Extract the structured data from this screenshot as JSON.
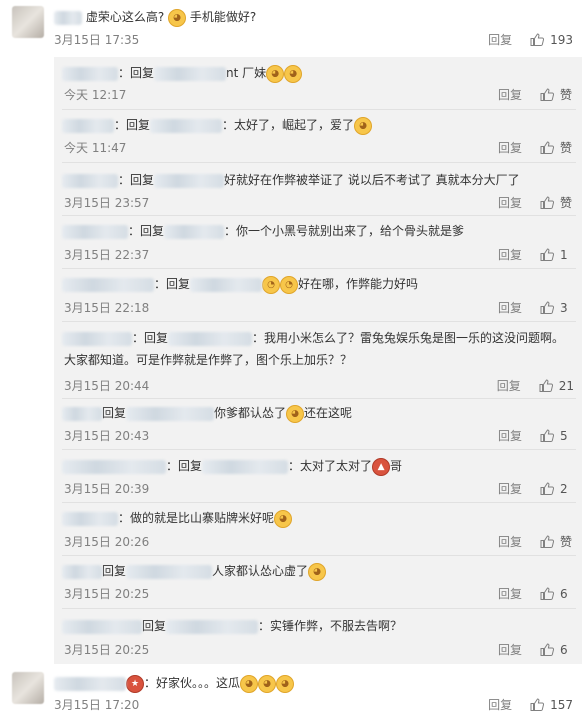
{
  "top_comment": {
    "text_a": "虚荣心这么高?",
    "text_b": "手机能做好?",
    "time": "3月15日 17:35",
    "reply_label": "回复",
    "likes": "193"
  },
  "replies": [
    {
      "prefix": "：回复",
      "tail": "nt 厂妹",
      "post_emoji": "😆😆",
      "time": "今天 12:17",
      "reply_label": "回复",
      "likes": "赞"
    },
    {
      "prefix": "：回复",
      "tail": "：太好了，崛起了，爱了",
      "post_emoji": "😊",
      "time": "今天 11:47",
      "reply_label": "回复",
      "likes": "赞"
    },
    {
      "prefix": "：回复",
      "tail": "好就好在作弊被举证了 说以后不考试了 真就本分大厂了",
      "time": "3月15日 23:57",
      "reply_label": "回复",
      "likes": "赞"
    },
    {
      "prefix": "：回复",
      "tail": "：你一个小黑号就别出来了，给个骨头就是爹",
      "time": "3月15日 22:37",
      "reply_label": "回复",
      "likes": "1"
    },
    {
      "prefix": "：回复",
      "tail": "好在哪，作弊能力好吗",
      "mid_emoji": "🤔🤔",
      "time": "3月15日 22:18",
      "reply_label": "回复",
      "likes": "3"
    },
    {
      "prefix": "：回复",
      "tail": "：我用小米怎么了？雷兔兔娱乐兔是图一乐的这没问题啊。",
      "tail2": "大家都知道。可是作弊就是作弊了，图个乐上加乐？？",
      "time": "3月15日 20:44",
      "reply_label": "回复",
      "likes": "21"
    },
    {
      "prefix": "回复",
      "tail": "你爹都认怂了",
      "tail_b": "还在这呢",
      "time": "3月15日 20:43",
      "reply_label": "回复",
      "likes": "5"
    },
    {
      "prefix": "：回复",
      "tail": "：太对了太对了",
      "tail_b": "哥",
      "time": "3月15日 20:39",
      "reply_label": "回复",
      "likes": "2"
    },
    {
      "prefix": "：",
      "tail": "做的就是比山寨贴牌米好呢",
      "time": "3月15日 20:26",
      "reply_label": "回复",
      "likes": "赞"
    },
    {
      "prefix": "回复",
      "tail": "人家都认怂心虚了",
      "time": "3月15日 20:25",
      "reply_label": "回复",
      "likes": "6"
    },
    {
      "prefix": "回复",
      "tail": "：实锤作弊，不服去告啊？",
      "time": "3月15日 20:25",
      "reply_label": "回复",
      "likes": "6"
    }
  ],
  "bottom_comment": {
    "text": "：好家伙。。。这瓜",
    "time": "3月15日 17:20",
    "reply_label": "回复",
    "likes": "157"
  },
  "icons": {
    "like": "thumbs-up-icon",
    "emoji": "emoji-face-icon"
  },
  "colors": {
    "panel_bg": "#f2f2f2",
    "meta": "#808080",
    "text": "#333333"
  }
}
